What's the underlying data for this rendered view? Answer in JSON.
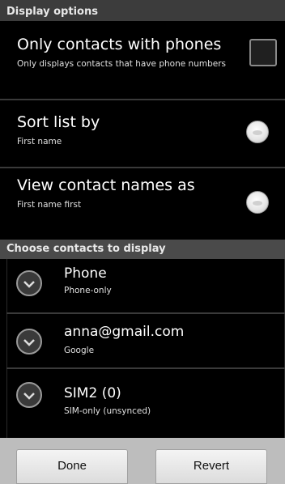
{
  "display_options": {
    "header": "Display options",
    "only_phones": {
      "title": "Only contacts with phones",
      "subtitle": "Only displays contacts that have phone numbers",
      "checked": false
    },
    "sort_list": {
      "title": "Sort list by",
      "value": "First name"
    },
    "view_names": {
      "title": "View contact names as",
      "value": "First name first"
    }
  },
  "choose_contacts": {
    "header": "Choose contacts to display",
    "accounts": [
      {
        "name": "Phone",
        "type": "Phone-only"
      },
      {
        "name": "anna@gmail.com",
        "type": "Google"
      },
      {
        "name": "SIM2 (0)",
        "type": "SIM-only (unsynced)"
      }
    ]
  },
  "buttons": {
    "done": "Done",
    "revert": "Revert"
  }
}
